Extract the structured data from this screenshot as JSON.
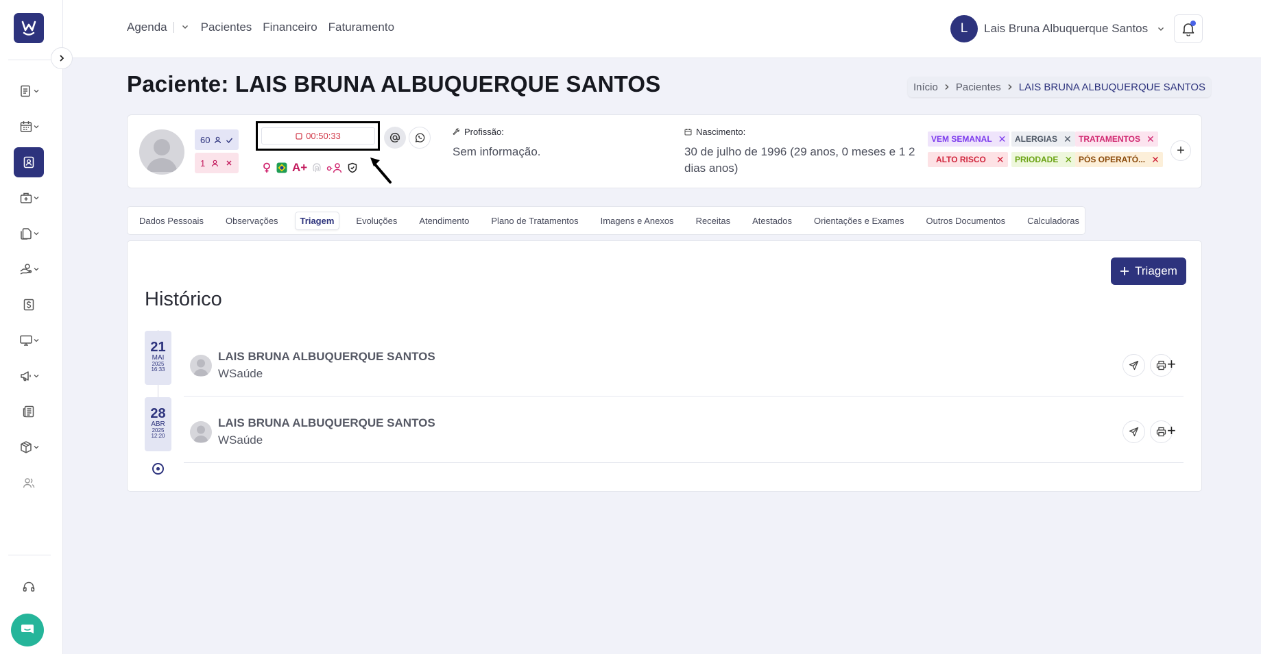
{
  "nav": {
    "items": [
      "Agenda",
      "Pacientes",
      "Financeiro",
      "Faturamento"
    ]
  },
  "user": {
    "initial": "L",
    "name": "Lais Bruna Albuquerque Santos"
  },
  "page": {
    "title": "Paciente: LAIS BRUNA ALBUQUERQUE SANTOS"
  },
  "breadcrumb": [
    "Início",
    "Pacientes",
    "LAIS BRUNA ALBUQUERQUE SANTOS"
  ],
  "patient": {
    "attended_count": "60",
    "missed_count": "1",
    "timer": "00:50:33",
    "blood_type": "A+",
    "profession_label": "Profissão:",
    "profession_value": "Sem informação.",
    "birth_label": "Nascimento:",
    "birth_value": "30 de julho de 1996 (29 anos, 0 meses e 1 2 dias anos)"
  },
  "tags": [
    {
      "label": "VEM SEMANAL",
      "color": "#7c3aed",
      "bg": "#efe4fb"
    },
    {
      "label": "ALERGIAS",
      "color": "#4b5563",
      "bg": "#eceef2"
    },
    {
      "label": "TRATAMENTOS",
      "color": "#d0266f",
      "bg": "#fce4ef"
    },
    {
      "label": "ALTO RISCO",
      "color": "#d0263d",
      "bg": "#fde2e5"
    },
    {
      "label": "PRIODADE",
      "color": "#6aa313",
      "bg": "#eef7dc"
    },
    {
      "label": "PÓS OPERATÓ...",
      "color": "#8a4a0a",
      "bg": "#fcefd9"
    }
  ],
  "tabs": [
    "Dados Pessoais",
    "Observações",
    "Triagem",
    "Evoluções",
    "Atendimento",
    "Plano de Tratamentos",
    "Imagens e Anexos",
    "Receitas",
    "Atestados",
    "Orientações e Exames",
    "Outros Documentos",
    "Calculadoras"
  ],
  "active_tab": "Triagem",
  "content": {
    "new_button": "Triagem",
    "history_title": "Histórico",
    "entries": [
      {
        "day": "21",
        "month": "MAI",
        "year": "2025",
        "time": "16:33",
        "name": "LAIS BRUNA ALBUQUERQUE SANTOS",
        "org": "WSaúde"
      },
      {
        "day": "28",
        "month": "ABR",
        "year": "2025",
        "time": "12:20",
        "name": "LAIS BRUNA ALBUQUERQUE SANTOS",
        "org": "WSaúde"
      }
    ]
  },
  "colors": {
    "brand": "#2d337d",
    "chat": "#25b59a",
    "timer": "#d13a4a"
  },
  "icons": [
    "logo-icon",
    "chevron-right-icon",
    "document-list-icon",
    "calendar-icon",
    "patient-card-icon",
    "briefcase-medical-icon",
    "copy-documents-icon",
    "hand-coins-icon",
    "dollar-icon",
    "monitor-icon",
    "megaphone-icon",
    "newspaper-icon",
    "box-icon",
    "users-icon",
    "headset-icon",
    "chat-icon",
    "bell-icon",
    "at-icon",
    "whatsapp-icon",
    "female-icon",
    "brazil-flag-icon",
    "fingerprint-icon",
    "glasses-person-icon",
    "shield-icon",
    "wrench-icon",
    "calendar-small-icon",
    "send-icon",
    "printer-icon"
  ]
}
